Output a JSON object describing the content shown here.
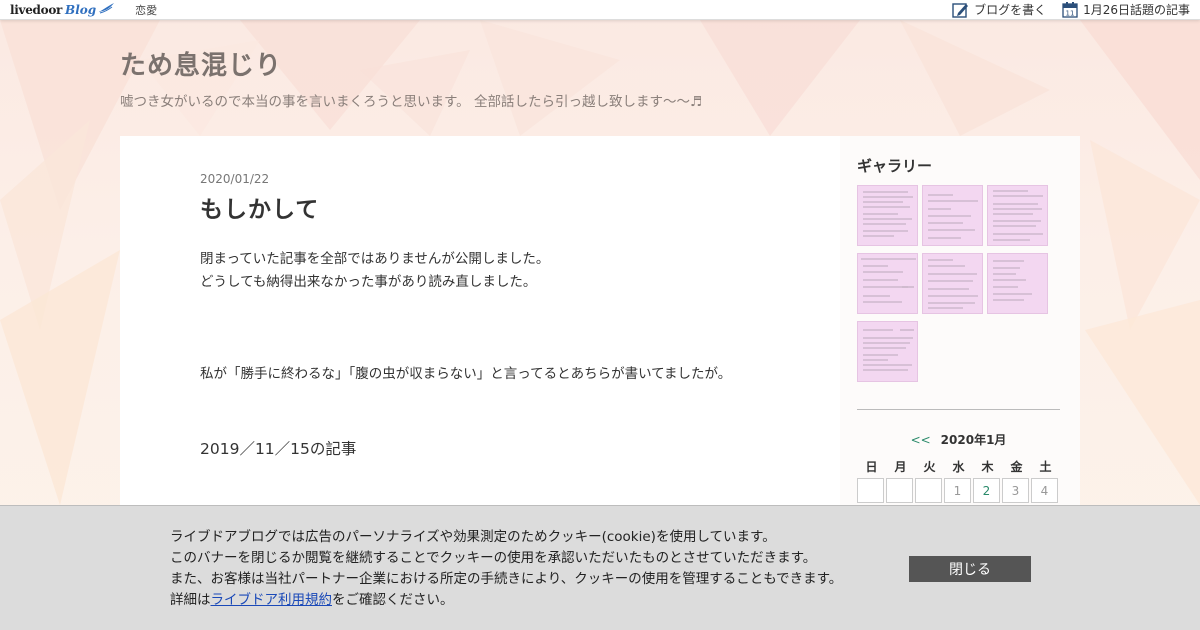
{
  "topbar": {
    "logo_text": "livedoor",
    "logo_blog": "Blog",
    "category": "恋愛",
    "write_blog": "ブログを書く",
    "calendar_day": "11",
    "topic_articles": "1月26日話題の記事"
  },
  "header": {
    "title": "ため息混じり",
    "description": "嘘つき女がいるので本当の事を言いまくろうと思います。 全部話したら引っ越し致します〜〜♬"
  },
  "post": {
    "date": "2020/01/22",
    "title": "もしかして",
    "para1_line1": "閉まっていた記事を全部ではありませんが公開しました。",
    "para1_line2": "どうしても納得出来なかった事があり読み直しました。",
    "para2": "私が「勝手に終わるな」「腹の虫が収まらない」と言ってるとあちらが書いてましたが。",
    "heading": "2019／11／15の記事"
  },
  "sidebar": {
    "gallery_title": "ギャラリー",
    "calendar": {
      "prev": "<<",
      "month": "2020年1月",
      "weekdays": [
        "日",
        "月",
        "火",
        "水",
        "木",
        "金",
        "土"
      ],
      "first_week": [
        "",
        "",
        "",
        "1",
        "2",
        "3",
        "4"
      ]
    }
  },
  "cookie": {
    "line1": "ライブドアブログでは広告のパーソナライズや効果測定のためクッキー(cookie)を使用しています。",
    "line2": "このバナーを閉じるか閲覧を継続することでクッキーの使用を承認いただいたものとさせていただきます。",
    "line3": "また、お客様は当社パートナー企業における所定の手続きにより、クッキーの使用を管理することもできます。",
    "line4_prefix": "詳細は",
    "line4_link": "ライブドア利用規約",
    "line4_suffix": "をご確認ください。",
    "close_label": "閉じる"
  },
  "colors": {
    "background": "#fbefe8",
    "title": "#7b726e",
    "link_green": "#2a8a6a",
    "thumbnail": "#f3d7f1",
    "close_button": "#555555",
    "cookie_link": "#1a49b8"
  }
}
